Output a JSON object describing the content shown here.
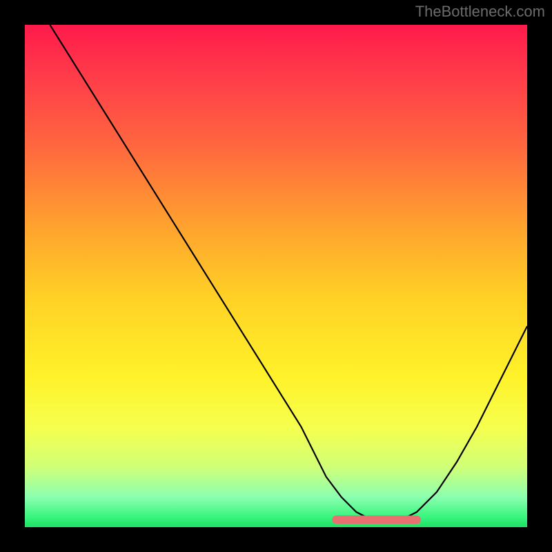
{
  "watermark": "TheBottleneck.com",
  "chart_data": {
    "type": "line",
    "title": "",
    "xlabel": "",
    "ylabel": "",
    "xlim": [
      0,
      100
    ],
    "ylim": [
      0,
      100
    ],
    "x": [
      5,
      10,
      15,
      20,
      25,
      30,
      35,
      40,
      45,
      50,
      55,
      58,
      60,
      63,
      66,
      69,
      72,
      75,
      78,
      82,
      86,
      90,
      94,
      98,
      100
    ],
    "values": [
      100,
      92,
      84,
      76,
      68,
      60,
      52,
      44,
      36,
      28,
      20,
      14,
      10,
      6,
      3,
      1.5,
      1.5,
      1.5,
      3,
      7,
      13,
      20,
      28,
      36,
      40
    ],
    "valley": {
      "x_start": 62,
      "x_end": 78,
      "y": 1.5
    }
  }
}
